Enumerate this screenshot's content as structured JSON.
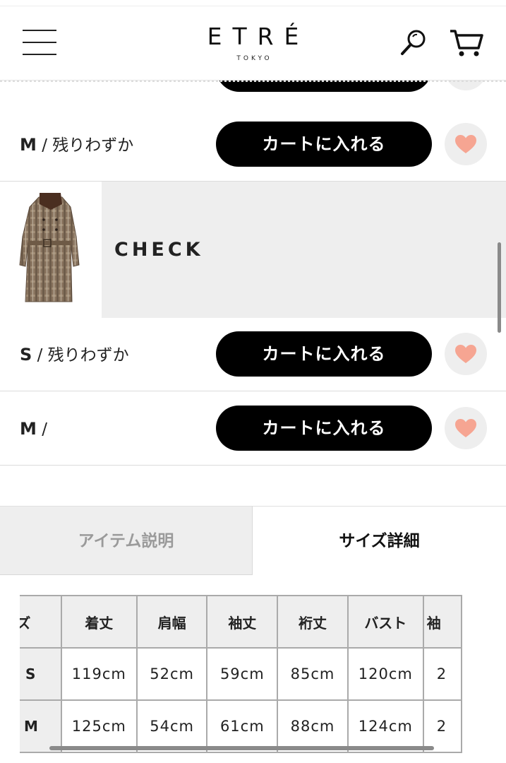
{
  "header": {
    "brand": "ETRÉ",
    "brand_sub": "TOKYO",
    "icons": [
      "menu-icon",
      "search-icon",
      "cart-icon"
    ]
  },
  "rows_before": [
    {
      "size": "M",
      "stock": " / 残りわずか",
      "cart_label": "カートに入れる"
    }
  ],
  "color_group": {
    "name": "CHECK",
    "rows": [
      {
        "size": "S",
        "stock": " / 残りわずか",
        "cart_label": "カートに入れる"
      },
      {
        "size": "M",
        "stock": " /",
        "cart_label": "カートに入れる"
      }
    ]
  },
  "tabs": [
    {
      "label": "アイテム説明",
      "active": false
    },
    {
      "label": "サイズ詳細",
      "active": true
    }
  ],
  "size_table": {
    "headers": [
      "イズ",
      "着丈",
      "肩幅",
      "袖丈",
      "裄丈",
      "バスト",
      "袖"
    ],
    "rows": [
      [
        "S",
        "119cm",
        "52cm",
        "59cm",
        "85cm",
        "120cm",
        "2"
      ],
      [
        "M",
        "125cm",
        "54cm",
        "61cm",
        "88cm",
        "124cm",
        "2"
      ]
    ]
  },
  "colors": {
    "cart_button": "#000000",
    "heart": "#f6a592",
    "band": "#eeeeee"
  }
}
